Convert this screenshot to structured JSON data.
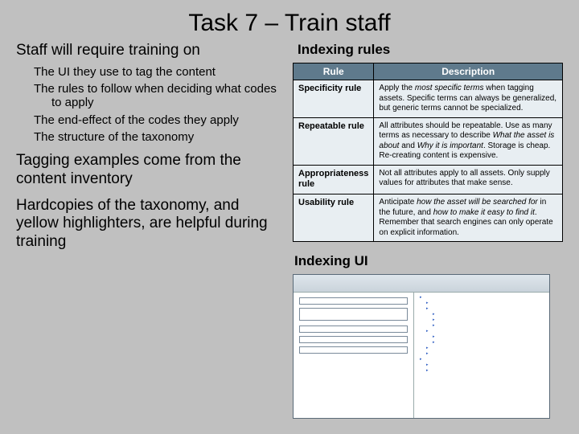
{
  "title": "Task 7 – Train staff",
  "section_table_title": "Indexing rules",
  "left": {
    "h_training": "Staff will require training on",
    "bullets": [
      "The UI they use to tag the content",
      "The rules to follow when deciding what codes to apply",
      "The end-effect of the codes they apply",
      "The structure of the taxonomy"
    ],
    "h_examples": "Tagging examples come from the content inventory",
    "h_hardcopies": "Hardcopies of the taxonomy, and yellow highlighters, are helpful during training"
  },
  "table": {
    "header_rule": "Rule",
    "header_desc": "Description",
    "rows": [
      {
        "name": "Specificity rule",
        "desc_pre": "Apply the ",
        "desc_em": "most specific terms",
        "desc_post": " when tagging assets. Specific terms can always be generalized, but generic terms cannot be specialized."
      },
      {
        "name": "Repeatable rule",
        "desc_pre": "All attributes should be repeatable. Use as many terms as necessary to describe ",
        "desc_em": "What the asset is about",
        "desc_mid": " and ",
        "desc_em2": "Why it is important",
        "desc_post": ". Storage is cheap. Re-creating content is expensive."
      },
      {
        "name": "Appropriateness rule",
        "desc_pre": "Not all attributes apply to all assets. Only supply values for attributes that make sense.",
        "desc_em": "",
        "desc_post": ""
      },
      {
        "name": "Usability rule",
        "desc_pre": "Anticipate ",
        "desc_em": "how the asset will be searched for",
        "desc_mid": " in the future, and ",
        "desc_em2": "how to make it easy to find it",
        "desc_post": ". Remember that search engines can only operate on explicit information."
      }
    ]
  },
  "ui_section_title": "Indexing UI"
}
